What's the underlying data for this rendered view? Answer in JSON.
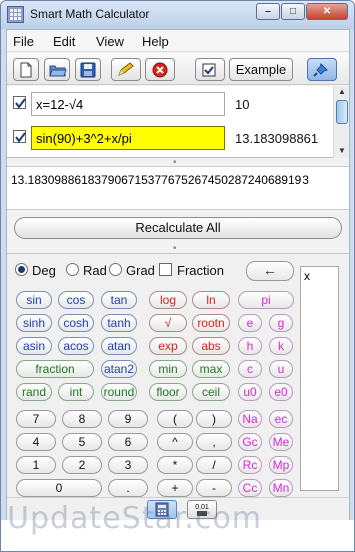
{
  "window": {
    "title": "Smart Math Calculator"
  },
  "menu": [
    "File",
    "Edit",
    "View",
    "Help"
  ],
  "toolbar": {
    "example_label": "Example"
  },
  "expressions": [
    {
      "expr": "x=12-√4",
      "result": "10",
      "checked": true,
      "active": false
    },
    {
      "expr": "sin(90)+3^2+x/pi",
      "result": "13.183098861",
      "checked": true,
      "active": true
    }
  ],
  "full_result": "13.18309886183790671537767526745028724068919 3",
  "recalculate_label": "Recalculate All",
  "angle": {
    "options": [
      "Deg",
      "Rad",
      "Grad"
    ],
    "selected": "Deg",
    "fraction_label": "Fraction",
    "backspace": "←"
  },
  "keys": {
    "blue": [
      "sin",
      "cos",
      "tan",
      "sinh",
      "cosh",
      "tanh",
      "asin",
      "acos",
      "atan",
      "atan2"
    ],
    "red": [
      "log",
      "ln",
      "√",
      "rootn",
      "exp",
      "abs"
    ],
    "green": [
      "fraction",
      "min",
      "max",
      "rand",
      "int",
      "round",
      "floor",
      "ceil"
    ],
    "purple": [
      "pi",
      "e",
      "g",
      "h",
      "k",
      "c",
      "u",
      "u0",
      "e0",
      "Na",
      "ec",
      "Gc",
      "Me",
      "Rc",
      "Mp",
      "Cc",
      "Mn"
    ],
    "digits": [
      "7",
      "8",
      "9",
      "4",
      "5",
      "6",
      "1",
      "2",
      "3",
      "0",
      "."
    ],
    "ops": [
      "(",
      ")",
      "^",
      ",",
      "*",
      "/",
      "+",
      "-"
    ]
  },
  "variables": [
    "x"
  ],
  "status": {
    "fraction_btn": "0.01"
  },
  "watermark": "UpdateStar.com"
}
